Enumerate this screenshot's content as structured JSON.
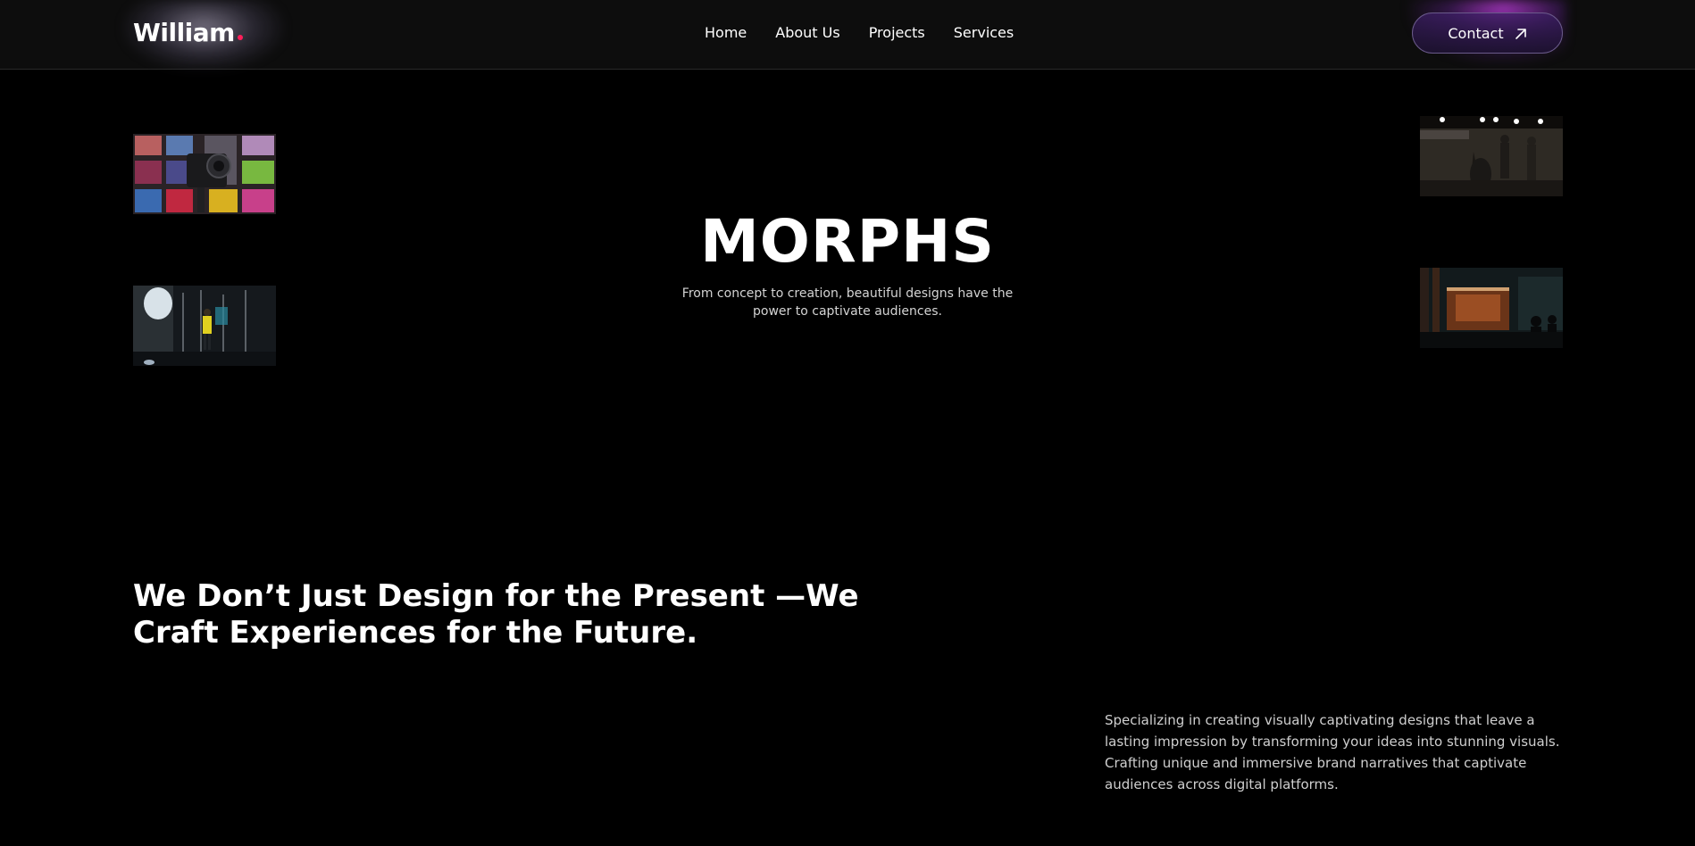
{
  "nav": {
    "logo": "William",
    "links": [
      "Home",
      "About Us",
      "Projects",
      "Services"
    ],
    "contact_label": "Contact"
  },
  "hero": {
    "title": "MORPHS",
    "subtitle": "From concept to creation, beautiful designs have the power to captivate audiences."
  },
  "section": {
    "tagline": "We Don’t Just Design for the Present —We Craft Experiences for the Future.",
    "description": "Specializing in creating visually captivating designs that leave a lasting impression by transforming your ideas into stunning visuals. Crafting unique and immersive brand narratives that captivate audiences across digital platforms."
  },
  "colors": {
    "background": "#000000",
    "navbar": "#0d0d0d",
    "logo_dot": "#ff1f5a",
    "contact_accent": "#7a3fc0"
  },
  "icons": {
    "contact": "arrow-up-right-icon"
  }
}
